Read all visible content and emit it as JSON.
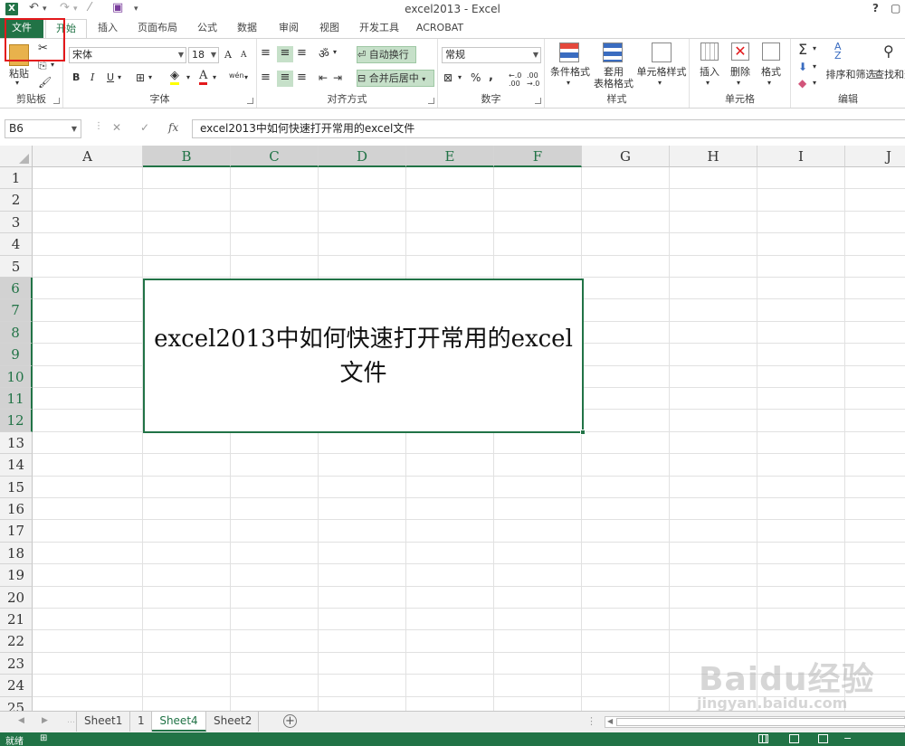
{
  "titlebar": {
    "app_icon": "X",
    "title": "excel2013 - Excel",
    "help": "?"
  },
  "tabs": [
    {
      "label": "文件"
    },
    {
      "label": "开始"
    },
    {
      "label": "插入"
    },
    {
      "label": "页面布局"
    },
    {
      "label": "公式"
    },
    {
      "label": "数据"
    },
    {
      "label": "审阅"
    },
    {
      "label": "视图"
    },
    {
      "label": "开发工具"
    },
    {
      "label": "ACROBAT"
    }
  ],
  "ribbon": {
    "clipboard": {
      "paste": "粘贴",
      "label": "剪贴板"
    },
    "font": {
      "name": "宋体",
      "size": "18",
      "bold": "B",
      "italic": "I",
      "underline": "U",
      "grow": "A",
      "shrink": "A",
      "phonetic": "wén",
      "label": "字体"
    },
    "align": {
      "wrap": "自动换行",
      "merge": "合并后居中",
      "label": "对齐方式"
    },
    "number": {
      "format": "常规",
      "percent": "%",
      "comma": ",",
      "label": "数字"
    },
    "styles": {
      "conditional": "条件格式",
      "table_format": "套用\n表格格式",
      "cell_styles": "单元格样式",
      "label": "样式"
    },
    "cells": {
      "insert": "插入",
      "delete": "删除",
      "format": "格式",
      "label": "单元格"
    },
    "editing": {
      "sort": "排序和筛选",
      "find": "查找和选择",
      "label": "编辑"
    }
  },
  "formula_bar": {
    "name_box": "B6",
    "fx": "fx",
    "formula": "excel2013中如何快速打开常用的excel文件"
  },
  "columns": [
    "A",
    "B",
    "C",
    "D",
    "E",
    "F",
    "G",
    "H",
    "I",
    "J"
  ],
  "selected_columns": [
    "B",
    "C",
    "D",
    "E",
    "F"
  ],
  "rows": [
    "1",
    "2",
    "3",
    "4",
    "5",
    "6",
    "7",
    "8",
    "9",
    "10",
    "11",
    "12",
    "13",
    "14",
    "15",
    "16",
    "17",
    "18",
    "19",
    "20",
    "21",
    "22",
    "23",
    "24",
    "25"
  ],
  "selected_rows": [
    "6",
    "7",
    "8",
    "9",
    "10",
    "11",
    "12"
  ],
  "merged_cell": {
    "text": "excel2013中如何快速打开常用的excel文件"
  },
  "sheets": [
    {
      "label": "Sheet1",
      "active": false
    },
    {
      "label": "1",
      "active": false
    },
    {
      "label": "Sheet4",
      "active": true
    },
    {
      "label": "Sheet2",
      "active": false
    }
  ],
  "status": {
    "text": "就绪"
  },
  "watermark": {
    "text": "Baidu经验",
    "url": "jingyan.baidu.com"
  },
  "colors": {
    "accent": "#217346",
    "highlight_box": "#e3191c"
  }
}
